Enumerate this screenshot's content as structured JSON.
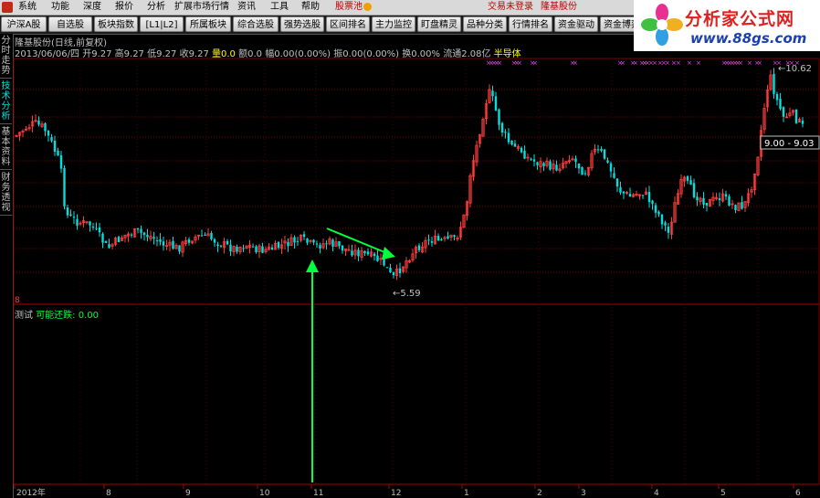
{
  "menu": {
    "items": [
      "系统",
      "功能",
      "深度",
      "报价",
      "分析",
      "扩展市场行情",
      "资讯",
      "工具",
      "帮助"
    ],
    "stock_pool": "股票池",
    "login_status": "交易未登录",
    "company": "隆基股份"
  },
  "toolbar": {
    "buttons": [
      "沪深A股",
      "自选股",
      "板块指数",
      "[L1|L2]",
      "所属板块",
      "综合选股",
      "强势选股",
      "区间排名",
      "主力监控",
      "盯盘精灵",
      "品种分类",
      "行情排名",
      "资金驱动",
      "资金博弈"
    ]
  },
  "brand": {
    "name": "分析家公式网",
    "url": "www.88gs.com"
  },
  "side_tabs": [
    "分时走势",
    "技术分析",
    "基本资料",
    "财务透视"
  ],
  "chart_header": {
    "stock_title": "隆基股份(日线,前复权)",
    "date": "2013/06/06/四",
    "open_label": "开",
    "open": "9.27",
    "high_label": "高",
    "high": "9.27",
    "low_label": "低",
    "low": "9.27",
    "close_label": "收",
    "close": "9.27",
    "volume_label": "量",
    "volume": "0.0",
    "amount_label": "额",
    "amount": "0.0",
    "change_label": "幅",
    "change": "0.00(0.00%)",
    "amplitude_label": "振",
    "amplitude": "0.00(0.00%)",
    "turnover_label": "换",
    "turnover": "0.00%",
    "float_label": "流通",
    "float_shares": "2.08亿",
    "sector": "半导体"
  },
  "chart_labels": {
    "high_mark": "10.62",
    "low_mark": "5.59",
    "range_box": "9.00 - 9.03",
    "top_scale": "8",
    "indicator_name": "测试",
    "indicator_series": "可能还跌:",
    "indicator_value": "0.00",
    "x_labels": [
      "2012年",
      "8",
      "9",
      "10",
      "11",
      "12",
      "1",
      "2",
      "3",
      "4",
      "5",
      "6"
    ]
  },
  "colors": {
    "up": "#ff3c3c",
    "down": "#00e0e0",
    "grid": "#7a0000",
    "arrow": "#00ff3c",
    "magenta": "#ff40ff",
    "yellow": "#ffff00"
  }
}
